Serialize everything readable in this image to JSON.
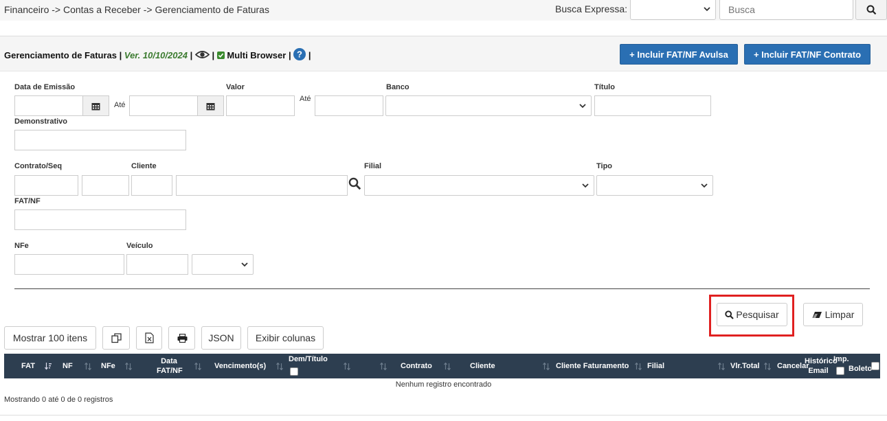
{
  "topbar": {
    "breadcrumb": "Financeiro -> Contas a Receber -> Gerenciamento de Faturas",
    "busca_label": "Busca Expressa:",
    "busca_placeholder": "Busca"
  },
  "header": {
    "title": "Gerenciamento de Faturas",
    "sep": "|",
    "version": "Ver. 10/10/2024",
    "multi_browser": "Multi Browser",
    "btn_avulsa": "+ Incluir FAT/NF Avulsa",
    "btn_contrato": "+ Incluir FAT/NF Contrato"
  },
  "filters": {
    "data_emissao": "Data de Emissão",
    "ate": "Até",
    "valor": "Valor",
    "banco": "Banco",
    "titulo": "Título",
    "demonstrativo": "Demonstrativo",
    "contrato_seq": "Contrato/Seq",
    "cliente": "Cliente",
    "filial": "Filial",
    "tipo": "Tipo",
    "fat_nf": "FAT/NF",
    "nfe": "NFe",
    "veiculo": "Veículo"
  },
  "actions": {
    "pesquisar": "Pesquisar",
    "limpar": "Limpar",
    "mostrar": "Mostrar 100 itens",
    "json": "JSON",
    "exibir_colunas": "Exibir colunas"
  },
  "table": {
    "columns": {
      "fat": "FAT",
      "nf": "NF",
      "nfe": "NFe",
      "data_fat_nf_1": "Data",
      "data_fat_nf_2": "FAT/NF",
      "vencimentos": "Vencimento(s)",
      "dem_titulo": "Dem/Título",
      "contrato": "Contrato",
      "cliente": "Cliente",
      "cliente_faturamento": "Cliente Faturamento",
      "filial": "Filial",
      "vlr_total": "Vlr.Total",
      "cancelar": "Cancelar",
      "historico_1": "Histórico",
      "historico_2": "Email",
      "imp_boleto_1": "Imp.",
      "imp_boleto_2": "Boleto"
    },
    "empty_message": "Nenhum registro encontrado",
    "info": "Mostrando 0 até 0 de 0 registros"
  },
  "colors": {
    "primary": "#2a6fb3",
    "table_header": "#2d3e50",
    "highlight": "#e02020",
    "version": "#3a7a2e"
  }
}
